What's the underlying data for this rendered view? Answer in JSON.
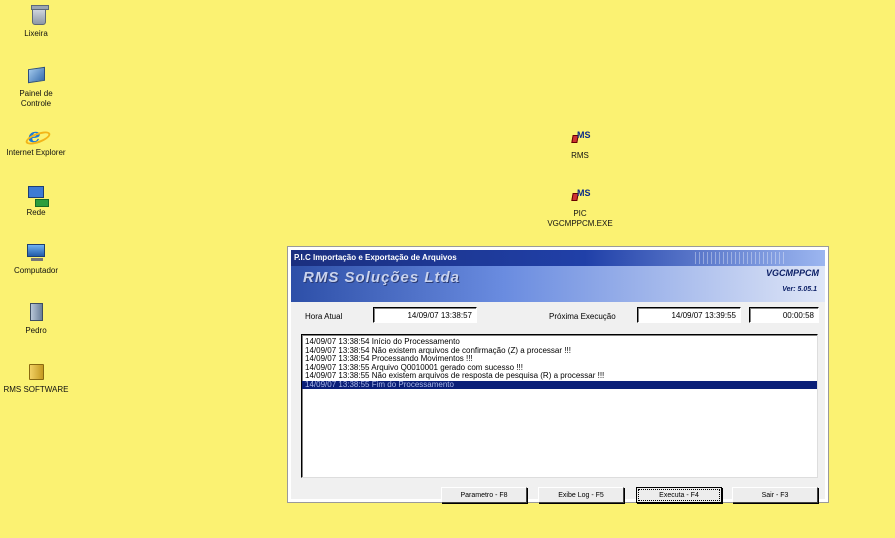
{
  "desktop": {
    "icons": [
      {
        "label": "Lixeira",
        "icon": "recycle-bin-icon"
      },
      {
        "label": "Painel de Controle",
        "icon": "control-panel-icon"
      },
      {
        "label": "Internet Explorer",
        "icon": "internet-explorer-icon"
      },
      {
        "label": "Rede",
        "icon": "network-icon"
      },
      {
        "label": "Computador",
        "icon": "computer-icon"
      },
      {
        "label": "Pedro",
        "icon": "user-folder-icon"
      },
      {
        "label": "RMS SOFTWARE",
        "icon": "folder-icon"
      },
      {
        "label": "RMS",
        "icon": "rms-icon"
      },
      {
        "label": "PIC VGCMPPCM.EXE",
        "icon": "rms-exe-icon"
      }
    ],
    "background_color": "#fbf272"
  },
  "window": {
    "title": "P.I.C  Importação e Exportação de Arquivos",
    "company": "RMS Soluções Ltda",
    "program_code": "VGCMPPCM",
    "version": "Ver: 5.05.1",
    "hora_atual_label": "Hora Atual",
    "hora_atual_value": "14/09/07 13:38:57",
    "proxima_label": "Próxima Execução",
    "proxima_value": "14/09/07 13:39:55",
    "countdown_value": "00:00:58",
    "log": [
      "14/09/07 13:38:54 Início do Processamento",
      "14/09/07 13:38:54 Não existem arquivos de confirmação (Z) a processar !!!",
      "14/09/07 13:38:54 Processando Movimentos !!!",
      "14/09/07 13:38:55 Arquivo Q0010001 gerado com sucesso !!!",
      "14/09/07 13:38:55 Não existem arquivos de resposta de pesquisa (R) a processar !!!",
      "14/09/07 13:38:55 Fim do Processamento"
    ],
    "buttons": {
      "parametro": "Parametro - F8",
      "exibe_log": "Exibe Log - F5",
      "executa": "Executa - F4",
      "sair": "Sair - F3"
    }
  }
}
